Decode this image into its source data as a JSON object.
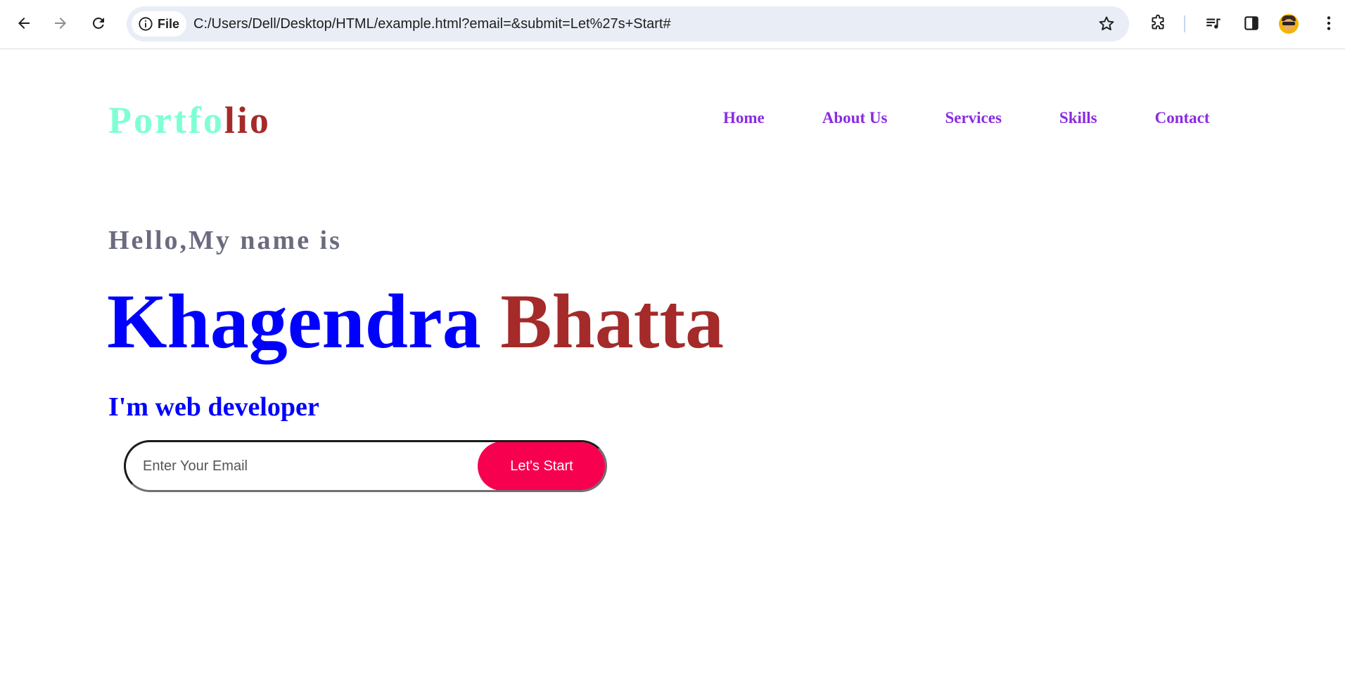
{
  "browser": {
    "site_chip_label": "File",
    "url": "C:/Users/Dell/Desktop/HTML/example.html?email=&submit=Let%27s+Start#",
    "icons": {
      "back": "back-arrow-icon",
      "forward": "forward-arrow-icon",
      "reload": "reload-icon",
      "info": "info-icon",
      "bookmark": "star-icon",
      "extensions": "puzzle-icon",
      "media": "media-control-icon",
      "side_panel": "side-panel-icon",
      "menu": "kebab-menu-icon"
    }
  },
  "header": {
    "logo_part1": "Portfo",
    "logo_part2": "lio",
    "nav": [
      "Home",
      "About Us",
      "Services",
      "Skills",
      "Contact"
    ]
  },
  "hero": {
    "greeting": "Hello,My name is",
    "first_name": "Khagendra",
    "last_name": "Bhatta",
    "role": "I'm web developer",
    "email_placeholder": "Enter Your Email",
    "email_value": "",
    "submit_label": "Let's Start"
  },
  "colors": {
    "logo_part1": "#7fffd4",
    "logo_part2": "#a52a2a",
    "nav_link": "#8a2be2",
    "greeting": "#6b6b80",
    "first_name": "#0000ff",
    "last_name": "#a52a2a",
    "role": "#0000ff",
    "submit_button": "#f7004f"
  }
}
